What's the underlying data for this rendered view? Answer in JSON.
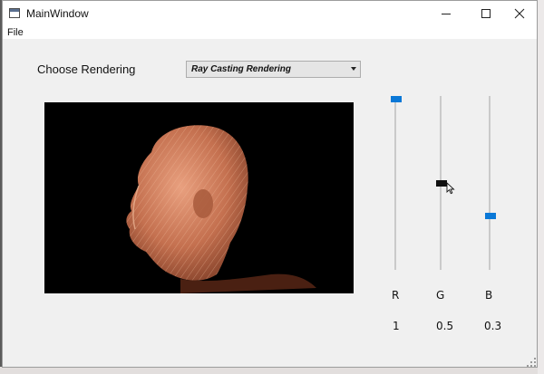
{
  "window": {
    "title": "MainWindow",
    "controls": [
      "minimize",
      "maximize",
      "close"
    ]
  },
  "menu": {
    "file": "File"
  },
  "rendering": {
    "label": "Choose Rendering",
    "selected": "Ray Casting Rendering"
  },
  "sliders": [
    {
      "label": "R",
      "value": "1",
      "level": 1.0
    },
    {
      "label": "G",
      "value": "0.5",
      "level": 0.5
    },
    {
      "label": "B",
      "value": "0.3",
      "level": 0.3
    }
  ],
  "colors": {
    "accent": "#0a78d7",
    "viewport_bg": "#000000",
    "volume_render": "#c8775a"
  },
  "icons": {
    "app": "app-window-icon",
    "minimize": "minimize-icon",
    "maximize": "maximize-icon",
    "close": "close-icon",
    "combo": "chevron-down-icon",
    "cursor": "mouse-pointer-icon"
  }
}
